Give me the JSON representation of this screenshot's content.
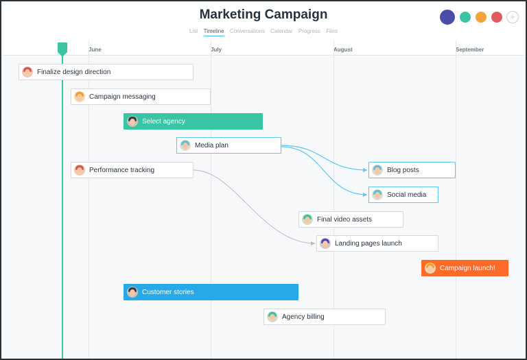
{
  "header": {
    "title": "Marketing Campaign",
    "tabs": [
      {
        "label": "List",
        "active": false
      },
      {
        "label": "Timeline",
        "active": true
      },
      {
        "label": "Conversations",
        "active": false
      },
      {
        "label": "Calendar",
        "active": false
      },
      {
        "label": "Progress",
        "active": false
      },
      {
        "label": "Files",
        "active": false
      }
    ],
    "members": [
      {
        "icon": "user-avatar",
        "color": "#4a4ea8"
      },
      {
        "icon": "user-avatar",
        "color": "#39c4a3"
      },
      {
        "icon": "user-avatar",
        "color": "#f4a33a"
      },
      {
        "icon": "user-avatar",
        "color": "#e05c5c"
      }
    ],
    "add_member_icon": "plus-icon",
    "add_member_glyph": "+"
  },
  "timeline": {
    "months": [
      "June",
      "July",
      "August",
      "September"
    ],
    "today_marker_icon": "today-marker-icon",
    "tasks": [
      {
        "id": "t1",
        "label": "Finalize design direction",
        "style": "default",
        "avatar": "#d9534f"
      },
      {
        "id": "t2",
        "label": "Campaign messaging",
        "style": "default",
        "avatar": "#f0a030"
      },
      {
        "id": "t3",
        "label": "Select agency",
        "style": "teal",
        "avatar": "#2c3e50"
      },
      {
        "id": "t4",
        "label": "Media plan",
        "style": "selected",
        "avatar": "#5bc0de"
      },
      {
        "id": "t5",
        "label": "Performance tracking",
        "style": "default",
        "avatar": "#d9534f"
      },
      {
        "id": "t6",
        "label": "Blog posts",
        "style": "selected",
        "avatar": "#5bc0de"
      },
      {
        "id": "t7",
        "label": "Social media",
        "style": "selected",
        "avatar": "#5bc0de"
      },
      {
        "id": "t8",
        "label": "Final video assets",
        "style": "default",
        "avatar": "#39c4a3"
      },
      {
        "id": "t9",
        "label": "Landing pages launch",
        "style": "default",
        "avatar": "#4a4ea8"
      },
      {
        "id": "t10",
        "label": "Campaign launch!",
        "style": "orange",
        "avatar": "#f0a030"
      },
      {
        "id": "t11",
        "label": "Customer stories",
        "style": "blue",
        "avatar": "#2c3e50"
      },
      {
        "id": "t12",
        "label": "Agency billing",
        "style": "default",
        "avatar": "#39c4a3"
      }
    ],
    "dependency_colors": {
      "selected": "#5ec6ef",
      "default": "#c4c8cc"
    }
  }
}
